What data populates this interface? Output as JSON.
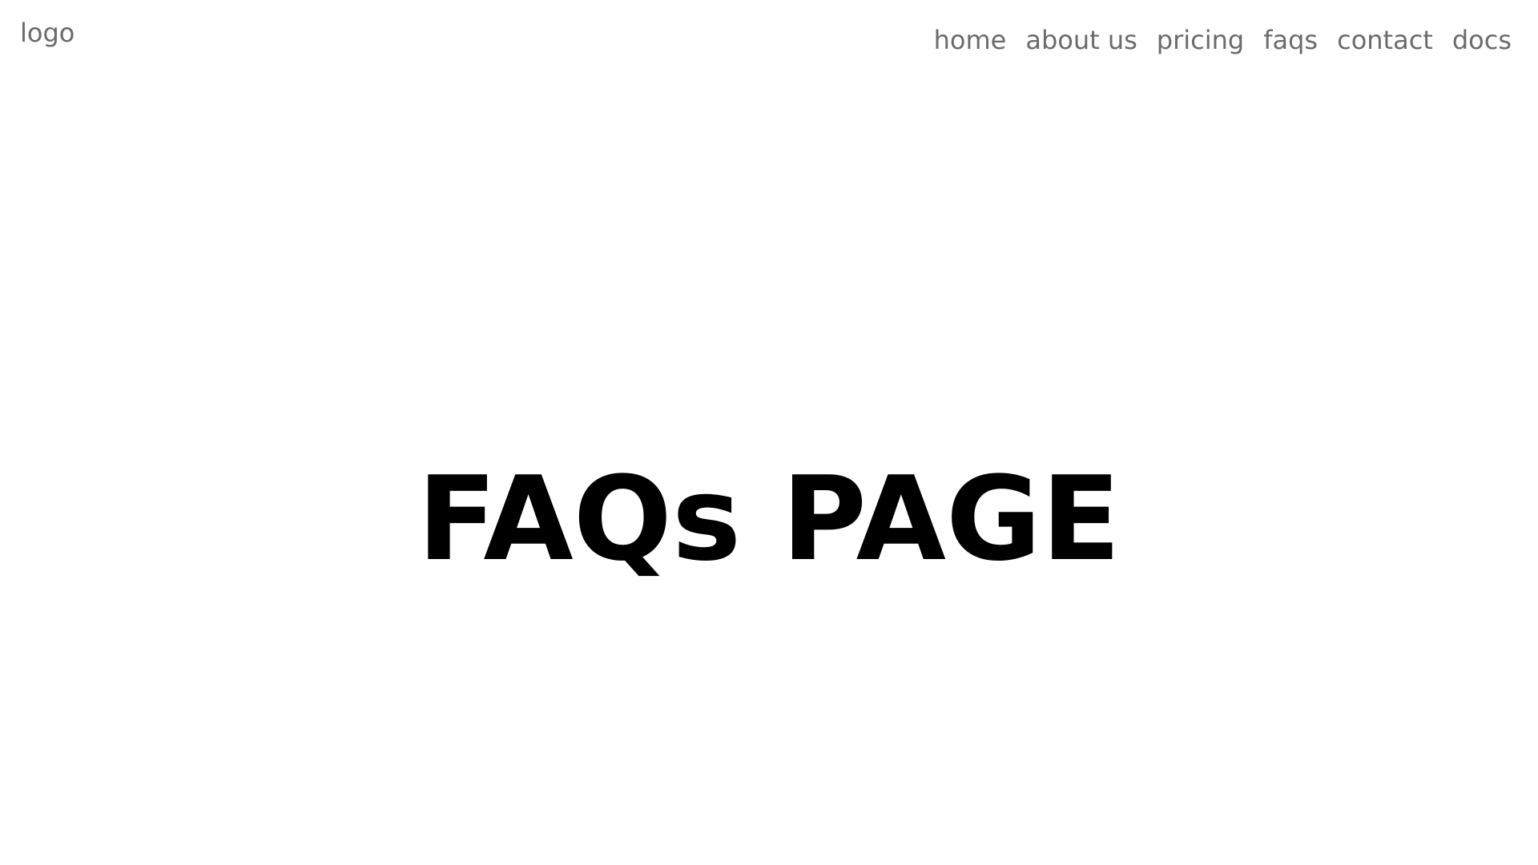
{
  "header": {
    "logo_text": "logo",
    "nav": [
      {
        "label": "home"
      },
      {
        "label": "about us"
      },
      {
        "label": "pricing"
      },
      {
        "label": "faqs"
      },
      {
        "label": "contact"
      },
      {
        "label": "docs"
      }
    ]
  },
  "main": {
    "title": "FAQs PAGE"
  },
  "colors": {
    "background": "#ffffff",
    "nav_text": "#6b6b6b",
    "title_text": "#000000"
  }
}
